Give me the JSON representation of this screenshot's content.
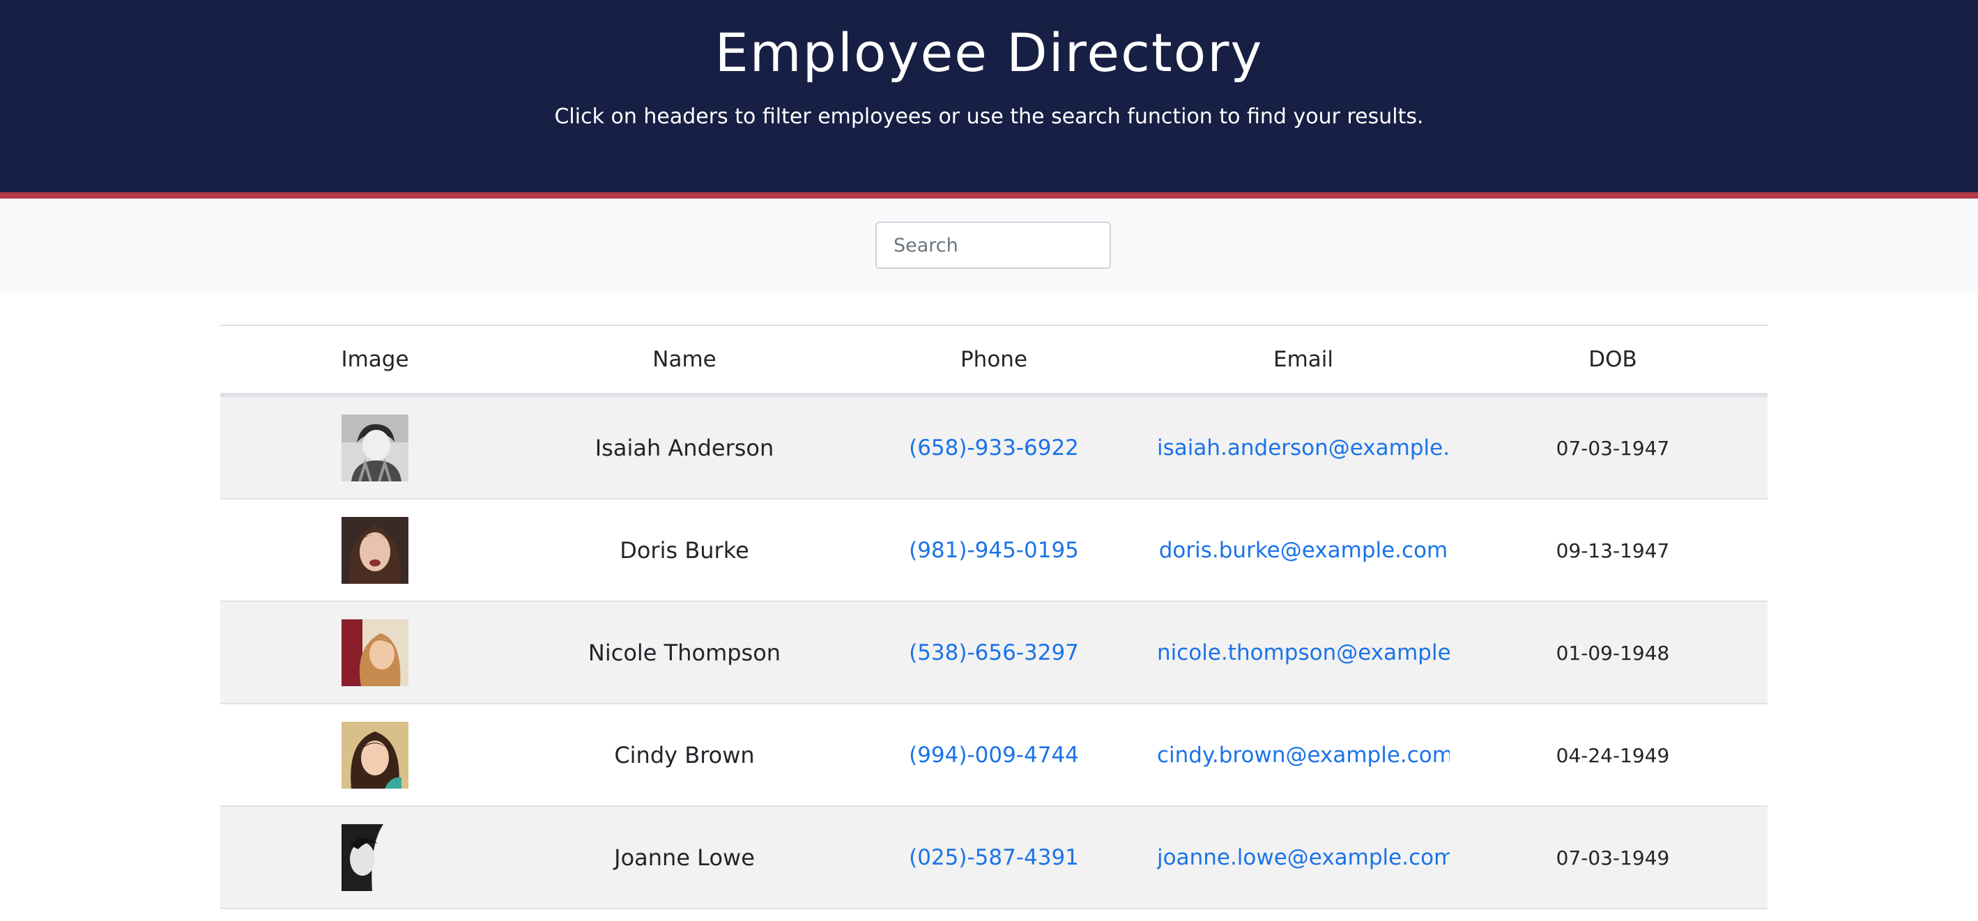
{
  "header": {
    "title": "Employee Directory",
    "subtitle": "Click on headers to filter employees or use the search function to find your results."
  },
  "search": {
    "placeholder": "Search"
  },
  "table": {
    "columns": [
      "Image",
      "Name",
      "Phone",
      "Email",
      "DOB"
    ],
    "rows": [
      {
        "image": "portrait-photo",
        "name": "Isaiah Anderson",
        "phone": "(658)-933-6922",
        "email": "isaiah.anderson@example.com",
        "dob": "07-03-1947"
      },
      {
        "image": "portrait-photo",
        "name": "Doris Burke",
        "phone": "(981)-945-0195",
        "email": "doris.burke@example.com",
        "dob": "09-13-1947"
      },
      {
        "image": "portrait-photo",
        "name": "Nicole Thompson",
        "phone": "(538)-656-3297",
        "email": "nicole.thompson@example.com",
        "dob": "01-09-1948"
      },
      {
        "image": "portrait-photo",
        "name": "Cindy Brown",
        "phone": "(994)-009-4744",
        "email": "cindy.brown@example.com",
        "dob": "04-24-1949"
      },
      {
        "image": "portrait-photo",
        "name": "Joanne Lowe",
        "phone": "(025)-587-4391",
        "email": "joanne.lowe@example.com",
        "dob": "07-03-1949"
      }
    ]
  },
  "colors": {
    "header_bg": "#171f44",
    "accent_line": "#b23a44",
    "link": "#1a73e8"
  }
}
